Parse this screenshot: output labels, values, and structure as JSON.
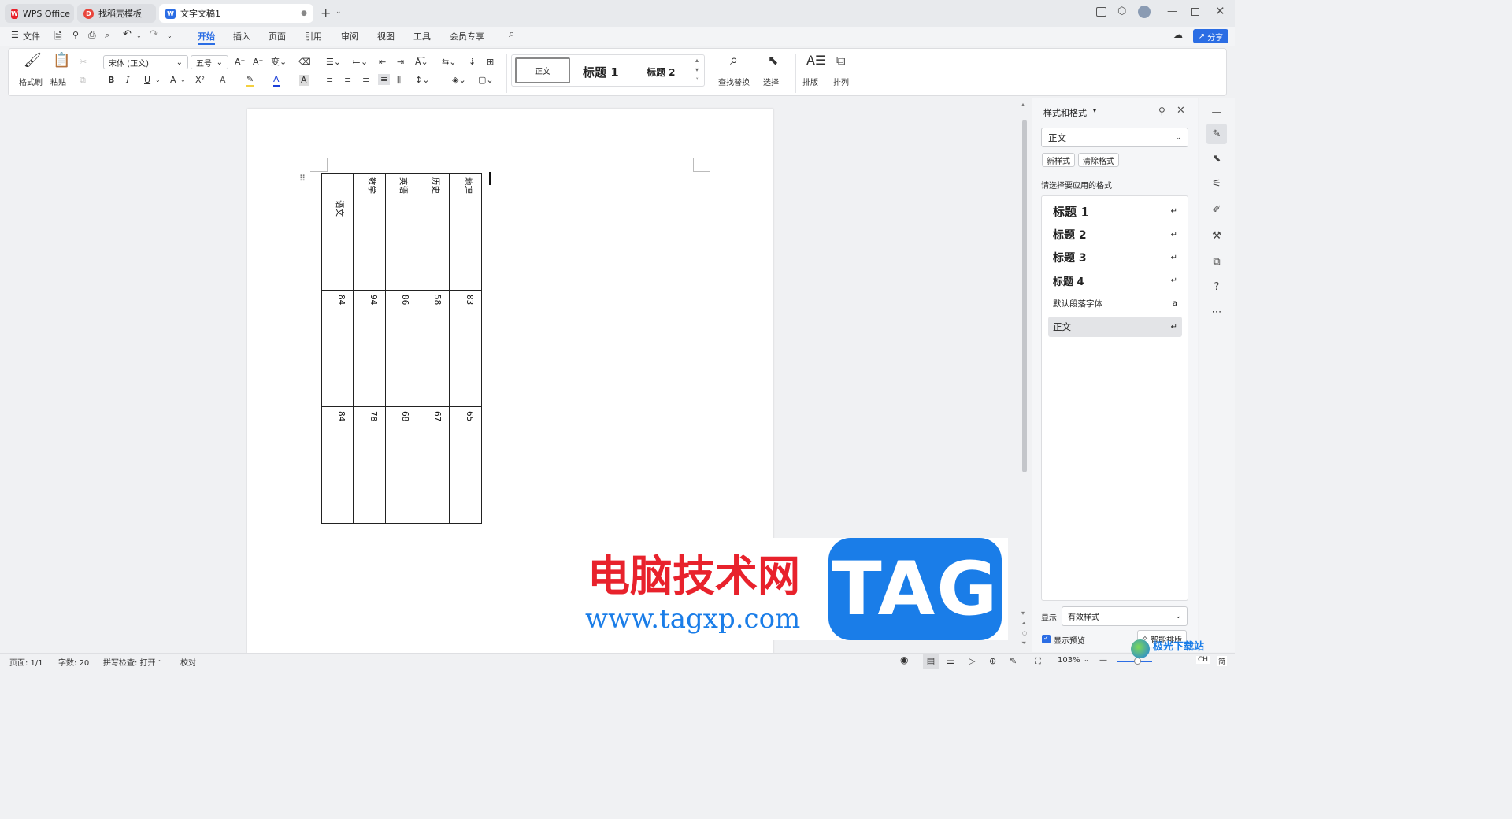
{
  "tabs": [
    {
      "label": "WPS Office"
    },
    {
      "label": "找稻壳模板"
    },
    {
      "label": "文字文稿1"
    }
  ],
  "menu": {
    "file": "文件",
    "tabs": [
      "开始",
      "插入",
      "页面",
      "引用",
      "审阅",
      "视图",
      "工具",
      "会员专享"
    ],
    "share": "分享"
  },
  "ribbon": {
    "format_painter": "格式刷",
    "paste": "粘贴",
    "font_name": "宋体 (正文)",
    "font_size": "五号",
    "bold": "B",
    "italic": "I",
    "underline": "U",
    "strike": "A",
    "superscript": "X²",
    "styles": [
      "正文",
      "标题 1",
      "标题 2"
    ],
    "find_replace": "查找替换",
    "select": "选择",
    "layout": "排版",
    "arrange": "排列"
  },
  "table": {
    "headers": [
      "语文",
      "数学",
      "英语",
      "历史",
      "地理"
    ],
    "row1": [
      "84",
      "94",
      "86",
      "58",
      "83"
    ],
    "row2": [
      "84",
      "78",
      "68",
      "67",
      "65"
    ]
  },
  "panel": {
    "title": "样式和格式",
    "current_style": "正文",
    "new_style": "新样式",
    "clear_format": "清除格式",
    "prompt": "请选择要应用的格式",
    "styles": [
      {
        "label": "标题  1",
        "mark": "↵"
      },
      {
        "label": "标题  2",
        "mark": "↵"
      },
      {
        "label": "标题  3",
        "mark": "↵"
      },
      {
        "label": "标题 4",
        "mark": "↵"
      },
      {
        "label": "默认段落字体",
        "mark": "a"
      },
      {
        "label": "正文",
        "mark": "↵"
      }
    ],
    "show_label": "显示",
    "show_value": "有效样式",
    "preview": "显示预览",
    "smart_layout": "智能排版"
  },
  "status": {
    "page": "页面: 1/1",
    "words": "字数: 20",
    "spell": "拼写检查: 打开",
    "proof": "校对",
    "zoom": "103%",
    "ime": "CH",
    "ime_mode": "简"
  },
  "watermark": {
    "title": "电脑技术网",
    "url": "www.tagxp.com",
    "badge": "TAG",
    "corner": "极光下载站"
  },
  "colors": {
    "accent": "#2b6de4",
    "watermark_red": "#e8222c",
    "watermark_blue": "#1a7de8",
    "tag_bg": "#1a7de8"
  }
}
